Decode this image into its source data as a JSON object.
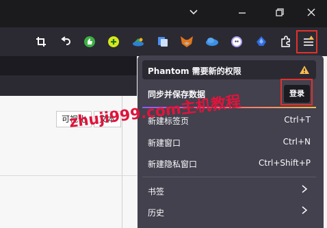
{
  "window_controls": {
    "minimize": "−",
    "maximize": "⧉",
    "close": "✕",
    "dropdown": "⌄"
  },
  "extension_icons": [
    "crop-icon",
    "undo-icon",
    "thumbs-up-extension-icon",
    "plus-extension-icon",
    "cloud-extension-icon",
    "translate-extension-icon",
    "metamask-fox-icon",
    "cloud-sync-icon",
    "phantom-ghost-icon",
    "spaceship-icon",
    "puzzle-extensions-icon",
    "hamburger-menu-icon"
  ],
  "page_tabs": {
    "visualize": "可视化",
    "text": "文本"
  },
  "menu": {
    "notice": "Phantom 需要新的权限",
    "sync": "同步并保存数据",
    "login": "登录",
    "items": [
      {
        "label": "新建标签页",
        "shortcut": "Ctrl+T"
      },
      {
        "label": "新建窗口",
        "shortcut": "Ctrl+N"
      },
      {
        "label": "新建隐私窗口",
        "shortcut": "Ctrl+Shift+P"
      },
      {
        "label": "书签"
      },
      {
        "label": "历史"
      }
    ]
  },
  "watermark": "zhuji999.com主机教程",
  "colors": {
    "highlight": "#e3312b",
    "watermark": "#e0143c",
    "menu_bg": "#42414d",
    "toolbar_bg": "#2b2a33"
  }
}
